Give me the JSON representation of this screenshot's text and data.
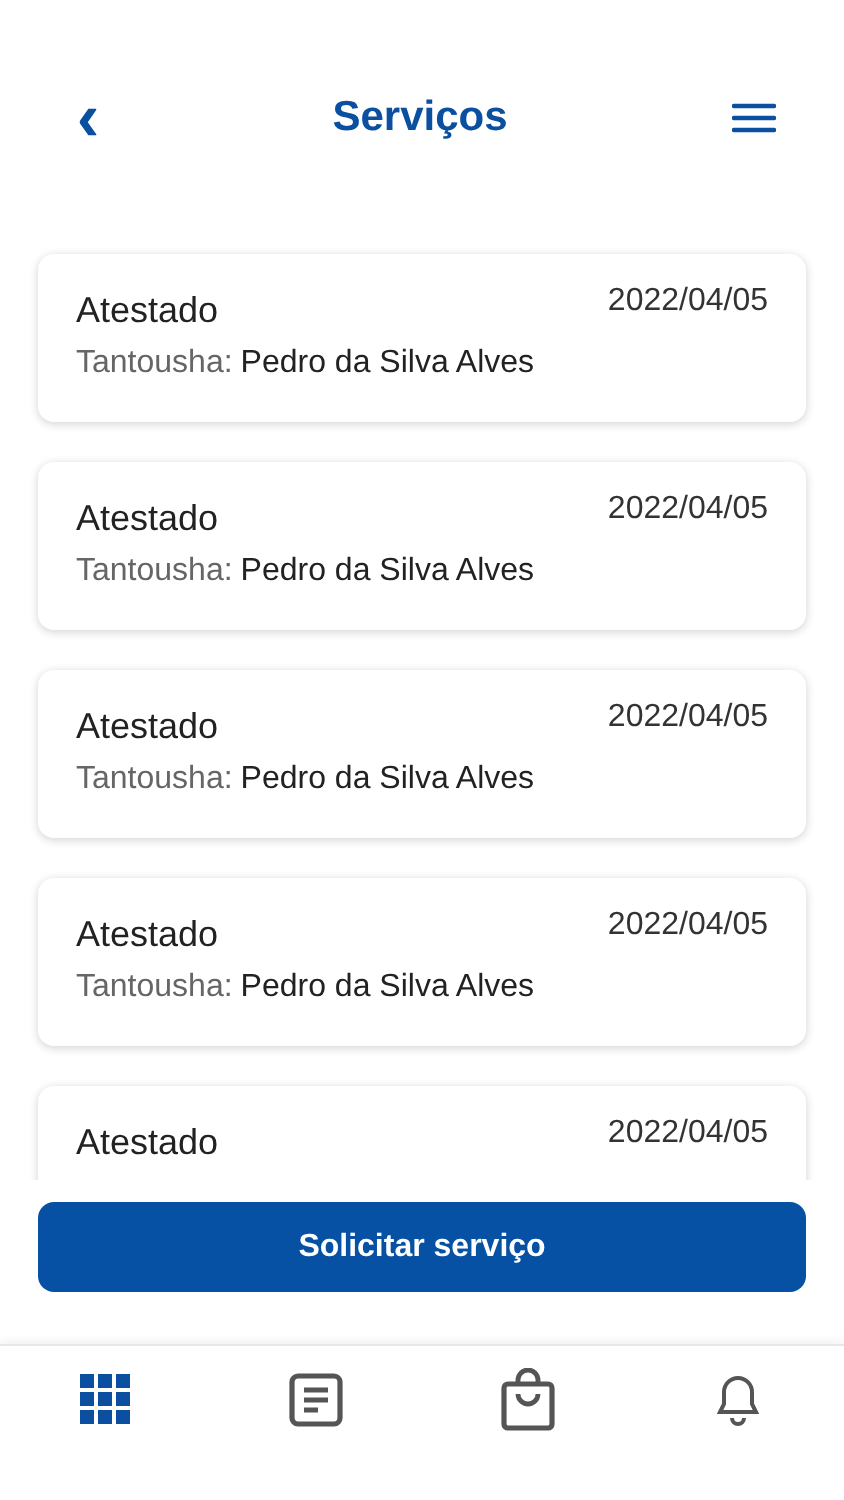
{
  "header": {
    "back": "‹",
    "title": "Serviços"
  },
  "services": [
    {
      "title": "Atestado",
      "date": "2022/04/05",
      "label": "Tantousha:",
      "person": "Pedro da Silva Alves"
    },
    {
      "title": "Atestado",
      "date": "2022/04/05",
      "label": "Tantousha:",
      "person": "Pedro da Silva Alves"
    },
    {
      "title": "Atestado",
      "date": "2022/04/05",
      "label": "Tantousha:",
      "person": "Pedro da Silva Alves"
    },
    {
      "title": "Atestado",
      "date": "2022/04/05",
      "label": "Tantousha:",
      "person": "Pedro da Silva Alves"
    },
    {
      "title": "Atestado",
      "date": "2022/04/05"
    }
  ],
  "action_button": "Solicitar serviço",
  "bottom_nav": [
    {
      "kind": "grid",
      "selected": true
    },
    {
      "kind": "document",
      "selected": false
    },
    {
      "kind": "bag",
      "selected": false
    },
    {
      "kind": "bell",
      "selected": false
    }
  ]
}
